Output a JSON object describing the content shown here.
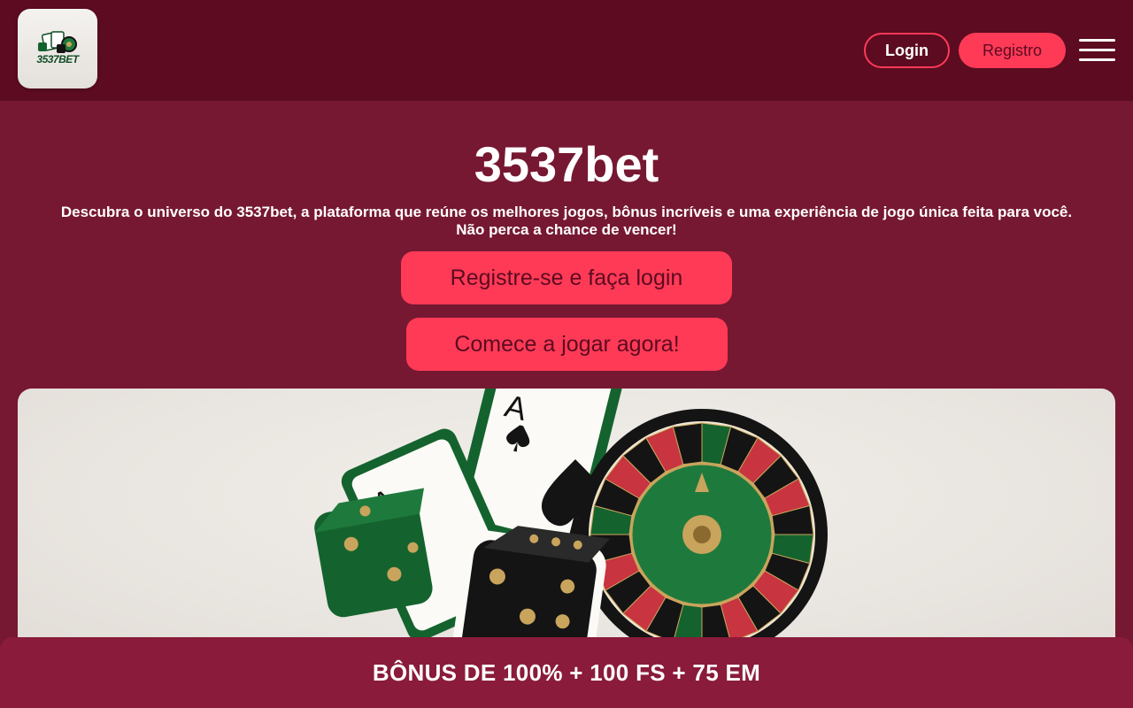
{
  "header": {
    "logo_text": "3537BET",
    "login_label": "Login",
    "register_label": "Registro"
  },
  "main": {
    "title": "3537bet",
    "description_line1": "Descubra o universo do 3537bet, a plataforma que reúne os melhores jogos, bônus incríveis e uma experiência de jogo única feita para você.",
    "description_line2": "Não perca a chance de vencer!",
    "cta_register": "Registre-se e faça login",
    "cta_play": "Comece a jogar agora!"
  },
  "hero": {
    "card_rank": "A",
    "colors": {
      "green": "#14632e",
      "black": "#141414",
      "red": "#c8343f",
      "gold": "#c9a45c"
    }
  },
  "bonus_bar": {
    "text": "BÔNUS DE 100% + 100 FS + 75 EM"
  },
  "colors": {
    "background": "#761832",
    "header": "#5c0b20",
    "accent": "#ff3a57"
  }
}
